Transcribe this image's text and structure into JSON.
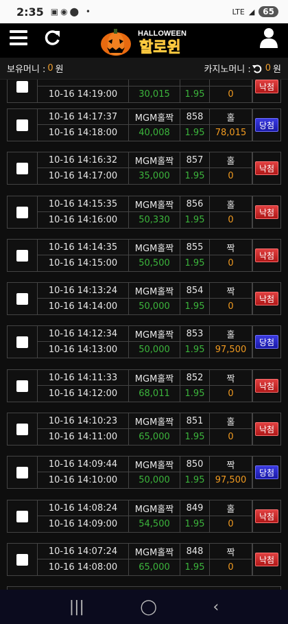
{
  "status_bar": {
    "time": "2:35",
    "battery": "65",
    "network": "LTE"
  },
  "header": {
    "logo_top": "HALLOWEEN",
    "logo_main": "할로윈"
  },
  "balance": {
    "holding_label": "보유머니 :",
    "holding_value": "0",
    "holding_unit": "원",
    "casino_label": "카지노머니 :",
    "casino_value": "0",
    "casino_unit": "원"
  },
  "rows": [
    {
      "time1": "",
      "time2": "10-16 14:19:00",
      "game": "",
      "round": "",
      "pick": "",
      "amount": "30,015",
      "odds": "1.95",
      "win": "0",
      "result": "낙첨",
      "result_type": "lose"
    },
    {
      "time1": "10-16 14:17:37",
      "time2": "10-16 14:18:00",
      "game": "MGM홀짝",
      "round": "858",
      "pick": "홀",
      "amount": "40,008",
      "odds": "1.95",
      "win": "78,015",
      "result": "당첨",
      "result_type": "win"
    },
    {
      "time1": "10-16 14:16:32",
      "time2": "10-16 14:17:00",
      "game": "MGM홀짝",
      "round": "857",
      "pick": "홀",
      "amount": "35,000",
      "odds": "1.95",
      "win": "0",
      "result": "낙첨",
      "result_type": "lose"
    },
    {
      "time1": "10-16 14:15:35",
      "time2": "10-16 14:16:00",
      "game": "MGM홀짝",
      "round": "856",
      "pick": "홀",
      "amount": "50,330",
      "odds": "1.95",
      "win": "0",
      "result": "낙첨",
      "result_type": "lose"
    },
    {
      "time1": "10-16 14:14:35",
      "time2": "10-16 14:15:00",
      "game": "MGM홀짝",
      "round": "855",
      "pick": "짝",
      "amount": "50,500",
      "odds": "1.95",
      "win": "0",
      "result": "낙첨",
      "result_type": "lose"
    },
    {
      "time1": "10-16 14:13:24",
      "time2": "10-16 14:14:00",
      "game": "MGM홀짝",
      "round": "854",
      "pick": "짝",
      "amount": "50,000",
      "odds": "1.95",
      "win": "0",
      "result": "낙첨",
      "result_type": "lose"
    },
    {
      "time1": "10-16 14:12:34",
      "time2": "10-16 14:13:00",
      "game": "MGM홀짝",
      "round": "853",
      "pick": "홀",
      "amount": "50,000",
      "odds": "1.95",
      "win": "97,500",
      "result": "당첨",
      "result_type": "win"
    },
    {
      "time1": "10-16 14:11:33",
      "time2": "10-16 14:12:00",
      "game": "MGM홀짝",
      "round": "852",
      "pick": "짝",
      "amount": "68,011",
      "odds": "1.95",
      "win": "0",
      "result": "낙첨",
      "result_type": "lose"
    },
    {
      "time1": "10-16 14:10:23",
      "time2": "10-16 14:11:00",
      "game": "MGM홀짝",
      "round": "851",
      "pick": "홀",
      "amount": "65,000",
      "odds": "1.95",
      "win": "0",
      "result": "낙첨",
      "result_type": "lose"
    },
    {
      "time1": "10-16 14:09:44",
      "time2": "10-16 14:10:00",
      "game": "MGM홀짝",
      "round": "850",
      "pick": "짝",
      "amount": "50,000",
      "odds": "1.95",
      "win": "97,500",
      "result": "당첨",
      "result_type": "win"
    },
    {
      "time1": "10-16 14:08:24",
      "time2": "10-16 14:09:00",
      "game": "MGM홀짝",
      "round": "849",
      "pick": "홀",
      "amount": "54,500",
      "odds": "1.95",
      "win": "0",
      "result": "낙첨",
      "result_type": "lose"
    },
    {
      "time1": "10-16 14:07:24",
      "time2": "10-16 14:08:00",
      "game": "MGM홀짝",
      "round": "848",
      "pick": "짝",
      "amount": "65,000",
      "odds": "1.95",
      "win": "0",
      "result": "낙첨",
      "result_type": "lose"
    }
  ],
  "icons": {
    "menu": "hamburger-menu-icon",
    "refresh": "refresh-icon",
    "user": "user-icon",
    "nav_recent": "recent-apps-icon",
    "nav_home": "home-icon",
    "nav_back": "back-icon"
  },
  "colors": {
    "win_badge": "#2a2ac8",
    "lose_badge": "#c82020",
    "amount": "#3cb53c",
    "payout": "#f09a20"
  }
}
